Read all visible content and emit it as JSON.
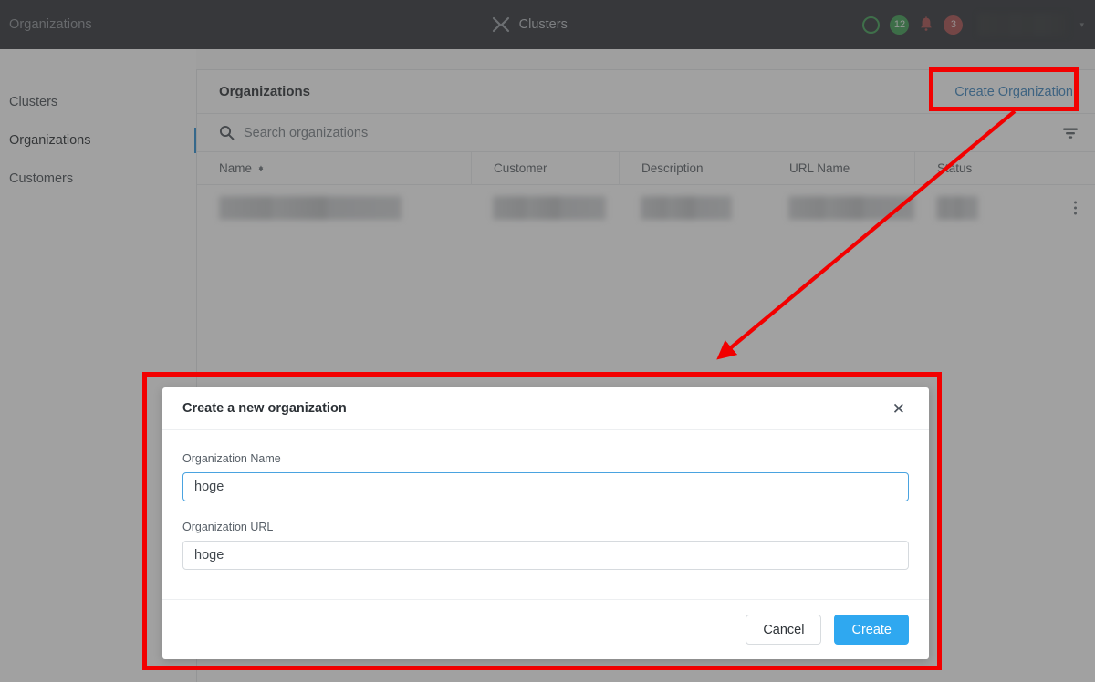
{
  "topbar": {
    "page_label": "Organizations",
    "brand": "Clusters",
    "logo_icon": "x-logo-icon",
    "status_ring_icon": "circle-status-icon",
    "status_count": "12",
    "bell_icon": "bell-icon",
    "alert_count": "3",
    "user_caret": "▾"
  },
  "sidebar": {
    "items": [
      {
        "label": "Clusters",
        "active": false
      },
      {
        "label": "Organizations",
        "active": true
      },
      {
        "label": "Customers",
        "active": false
      }
    ]
  },
  "main": {
    "card_title": "Organizations",
    "create_button": "Create Organization",
    "search_placeholder": "Search organizations",
    "search_value": "",
    "search_icon": "search-icon",
    "filter_icon": "filter-icon",
    "row_menu_icon": "kebab-menu-icon",
    "columns": [
      {
        "label": "Name",
        "sortable": true
      },
      {
        "label": "Customer",
        "sortable": false
      },
      {
        "label": "Description",
        "sortable": false
      },
      {
        "label": "URL Name",
        "sortable": false
      },
      {
        "label": "Status",
        "sortable": false
      }
    ],
    "rows": [
      {
        "name": "",
        "customer": "",
        "description": "",
        "url_name": "",
        "status": ""
      }
    ]
  },
  "modal": {
    "title": "Create a new organization",
    "close_icon": "close-icon",
    "fields": [
      {
        "label": "Organization Name",
        "value": "hoge",
        "focused": true
      },
      {
        "label": "Organization URL",
        "value": "hoge",
        "focused": false
      }
    ],
    "cancel_button": "Cancel",
    "create_button": "Create"
  },
  "annotations": {
    "highlight_color": "#f20000",
    "arrow_from": "create-organization-button",
    "arrow_to": "create-organization-modal"
  },
  "colors": {
    "topbar_bg": "#2f3237",
    "accent_blue": "#2fa8f0",
    "link_blue": "#3e86c0",
    "active_indicator": "#2b8fd4",
    "badge_green": "#3c9c52",
    "badge_red": "#a84d4d",
    "annotation_red": "#f20000"
  }
}
